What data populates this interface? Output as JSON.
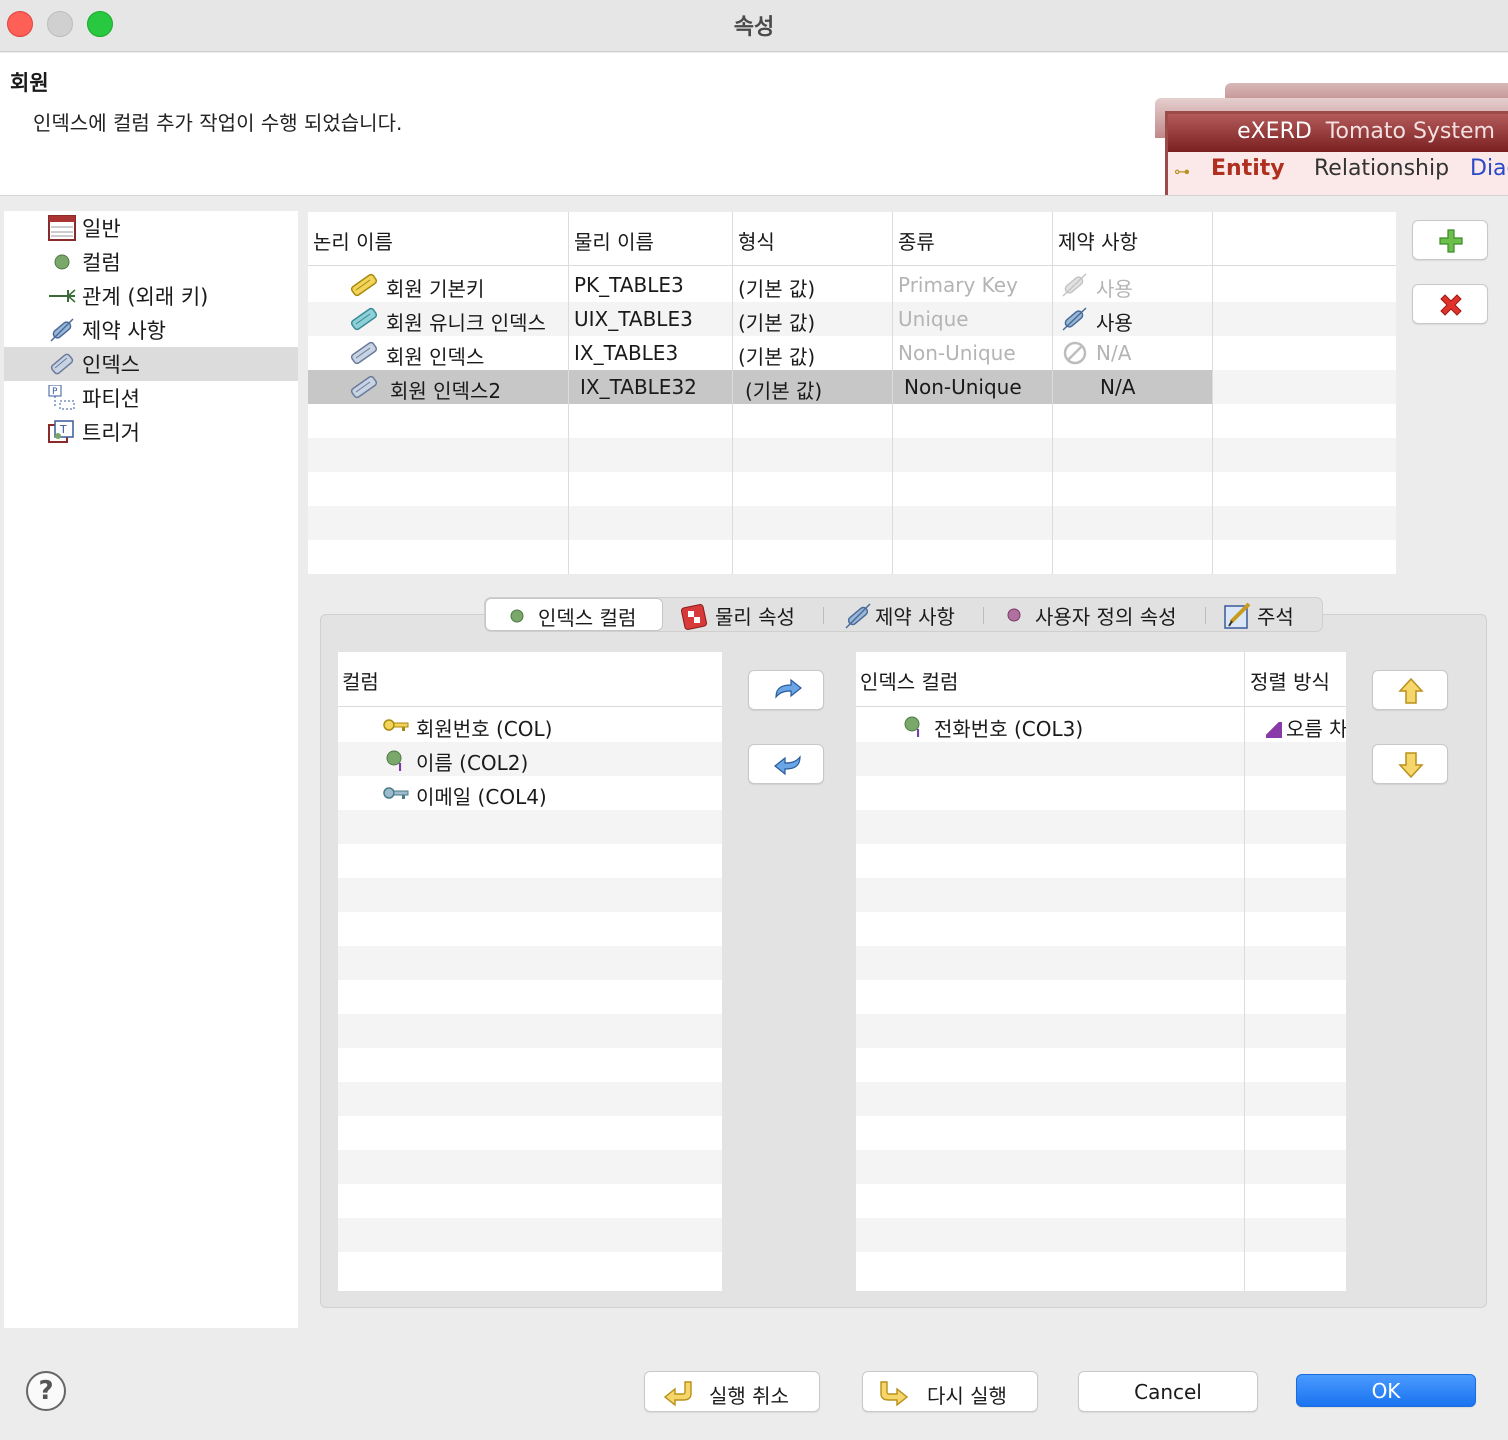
{
  "window": {
    "title": "속성"
  },
  "header": {
    "title": "회원",
    "message": "인덱스에 컬럼 추가 작업이 수행 되었습니다."
  },
  "banner": {
    "brand": "eXERD",
    "product": "Tomato System",
    "tabs": [
      "Entity",
      "Relationship",
      "Diag"
    ]
  },
  "sidebar": {
    "items": [
      {
        "label": "일반",
        "icon": "table-icon"
      },
      {
        "label": "컬럼",
        "icon": "column-dot-icon"
      },
      {
        "label": "관계 (외래 키)",
        "icon": "relation-icon"
      },
      {
        "label": "제약 사항",
        "icon": "constraint-icon"
      },
      {
        "label": "인덱스",
        "icon": "index-icon"
      },
      {
        "label": "파티션",
        "icon": "partition-icon"
      },
      {
        "label": "트리거",
        "icon": "trigger-icon"
      }
    ],
    "selected": "인덱스"
  },
  "index_table": {
    "headers": [
      "논리 이름",
      "물리 이름",
      "형식",
      "종류",
      "제약 사항"
    ],
    "rows": [
      {
        "logical": "회원 기본키",
        "physical": "PK_TABLE3",
        "format": "(기본 값)",
        "kind": "Primary Key",
        "constraint": "사용"
      },
      {
        "logical": "회원 유니크 인덱스",
        "physical": "UIX_TABLE3",
        "format": "(기본 값)",
        "kind": "Unique",
        "constraint": "사용"
      },
      {
        "logical": "회원 인덱스",
        "physical": "IX_TABLE3",
        "format": "(기본 값)",
        "kind": "Non-Unique",
        "constraint": "N/A"
      },
      {
        "logical": "회원 인덱스2",
        "physical": "IX_TABLE32",
        "format": "(기본 값)",
        "kind": "Non-Unique",
        "constraint": "N/A"
      }
    ]
  },
  "tabs": [
    "인덱스 컬럼",
    "물리 속성",
    "제약 사항",
    "사용자 정의 속성",
    "주석"
  ],
  "columns_list": {
    "header": "컬럼",
    "items": [
      "회원번호 (COL)",
      "이름 (COL2)",
      "이메일 (COL4)"
    ]
  },
  "index_columns": {
    "headers": [
      "인덱스 컬럼",
      "정렬 방식"
    ],
    "rows": [
      {
        "column": "전화번호 (COL3)",
        "order": "오름 차"
      }
    ]
  },
  "footer": {
    "undo": "실행 취소",
    "redo": "다시 실행",
    "cancel": "Cancel",
    "ok": "OK",
    "help": "?"
  },
  "colors": {
    "accent": "#1a73f0",
    "selected_row": "#c7c7c7",
    "banner": "#9c4a4a"
  }
}
